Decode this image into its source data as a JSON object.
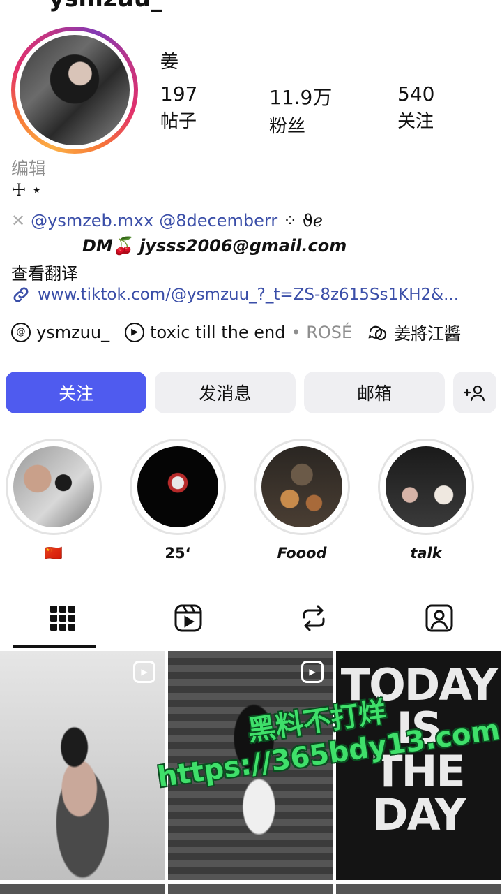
{
  "profile": {
    "username_partial": "ysmzuu_",
    "display_name": "姜",
    "stats": [
      {
        "value": "197",
        "label": "帖子"
      },
      {
        "value": "11.9万",
        "label": "粉丝"
      },
      {
        "value": "540",
        "label": "关注"
      }
    ],
    "edit_label": "编辑",
    "bio_symbols": "☩ ⋆",
    "bio_mention_1": "@ysmzeb.mxx",
    "bio_mention_2": "@8decemberr",
    "bio_trailing": "⁘ ϑℯ",
    "dm_line": "DM🍒 jysss2006@gmail.com",
    "translate_label": "查看翻译",
    "link": "www.tiktok.com/@ysmzuu_?_t=ZS-8z615Ss1KH2&...",
    "chips": {
      "threads": "ysmzuu_",
      "music_title": "toxic till the end",
      "music_artist": "• ROSÉ",
      "group": "姜將江醬"
    }
  },
  "buttons": {
    "follow": "关注",
    "message": "发消息",
    "email": "邮箱",
    "add_person_icon": "+👤"
  },
  "highlights": [
    {
      "label": "🇨🇳"
    },
    {
      "label": "25‘"
    },
    {
      "label": "Foood"
    },
    {
      "label": "talk"
    }
  ],
  "tabs": [
    {
      "icon": "grid-icon"
    },
    {
      "icon": "reels-icon"
    },
    {
      "icon": "repost-icon"
    },
    {
      "icon": "tagged-icon"
    }
  ],
  "posts": [
    {
      "type": "reel"
    },
    {
      "type": "reel"
    },
    {
      "type": "image",
      "text": [
        "TODAY",
        "IS",
        "THE",
        "DAY"
      ]
    }
  ],
  "watermark": {
    "line1": "黑料不打烊",
    "line2": "https://365bdy13.com"
  }
}
